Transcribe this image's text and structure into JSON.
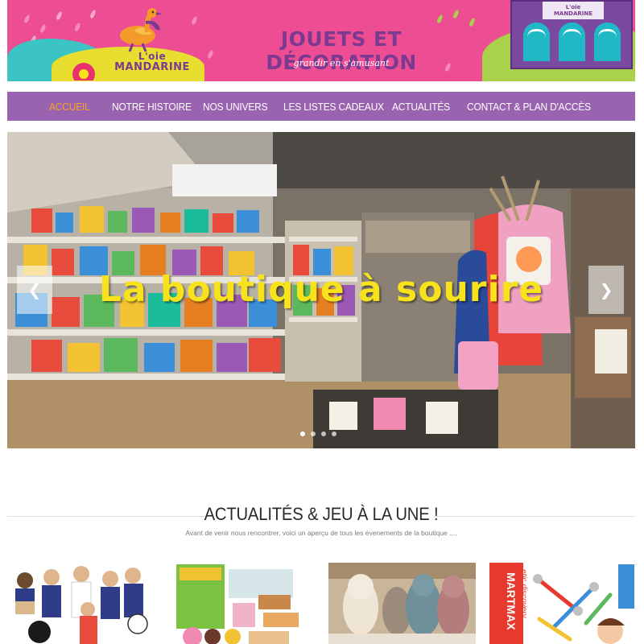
{
  "header": {
    "logo_line1": "L'oie",
    "logo_line2": "MANDARINE",
    "title": "JOUETS ET DÉCORATION",
    "subtitle": "grandir en s'amusant",
    "shop_sign_line1": "L'oie",
    "shop_sign_line2": "MANDARINE"
  },
  "nav": {
    "items": [
      {
        "label": "ACCUEIL",
        "active": true
      },
      {
        "label": "NOTRE HISTOIRE"
      },
      {
        "label": "NOS UNIVERS"
      },
      {
        "label": "LES LISTES CADEAUX"
      },
      {
        "label": "ACTUALITÉS"
      },
      {
        "label": "CONTACT & PLAN D'ACCÈS"
      }
    ],
    "active_color": "#f5a623",
    "bar_color": "#9a63b0"
  },
  "hero": {
    "caption": "La boutique à sourire",
    "prev_icon": "chevron-left-icon",
    "next_icon": "chevron-right-icon",
    "slide_count": 4,
    "active_slide": 1
  },
  "news": {
    "title": "ACTUALITÉS & JEU À LA UNE !",
    "subtitle": "Avant de venir nous rencontrer, voici un aperçu de tous les évenements de la boutique ....",
    "thumbnails": [
      {
        "alt": "wooden football figures"
      },
      {
        "alt": "cake making kit"
      },
      {
        "alt": "plush toys"
      },
      {
        "alt": "Smartmax magnetic discovery"
      }
    ]
  },
  "colors": {
    "banner_pink": "#ec4d93",
    "brand_purple": "#7b3a92",
    "caption_yellow": "#f7e21b"
  }
}
